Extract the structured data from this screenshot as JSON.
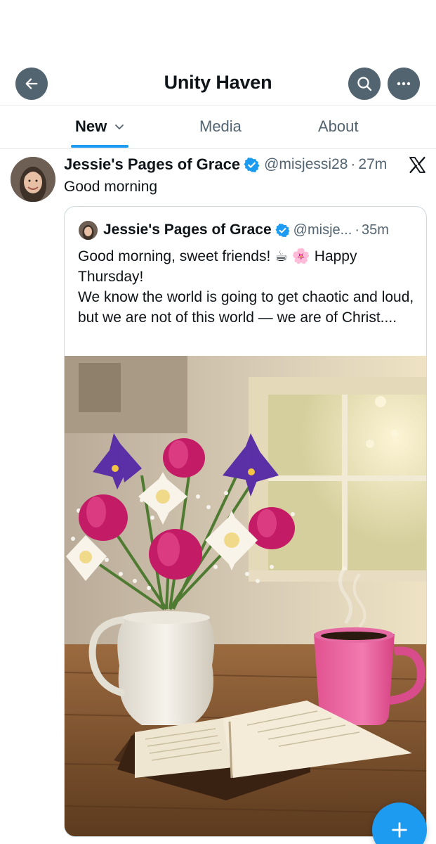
{
  "header": {
    "title": "Unity Haven",
    "back_icon": "arrow-left-icon",
    "search_icon": "search-icon",
    "more_icon": "more-horizontal-icon"
  },
  "tabs": [
    {
      "label": "New",
      "active": true,
      "has_dropdown": true
    },
    {
      "label": "Media",
      "active": false
    },
    {
      "label": "About",
      "active": false
    }
  ],
  "post": {
    "author_name": "Jessie's Pages of Grace",
    "handle": "@misjessi28",
    "separator": "·",
    "time": "27m",
    "verified": true,
    "text": "Good morning",
    "platform_icon": "x-logo-icon",
    "quoted": {
      "author_name": "Jessie's Pages of Grace",
      "handle": "@misje...",
      "separator": "·",
      "time": "35m",
      "verified": true,
      "text_line1": "Good morning, sweet friends! ☕ 🌸 Happy Thursday!",
      "text_line2": "We know the world is going to get chaotic and loud, but we are not of this world — we are of Christ....",
      "image_description_icon": "photo-flowers-coffee-bible"
    }
  },
  "fab": {
    "icon": "plus-icon"
  },
  "colors": {
    "accent": "#1d9bf0",
    "secondary_text": "#536471",
    "header_button": "#536471",
    "divider": "#e6e9ec"
  }
}
